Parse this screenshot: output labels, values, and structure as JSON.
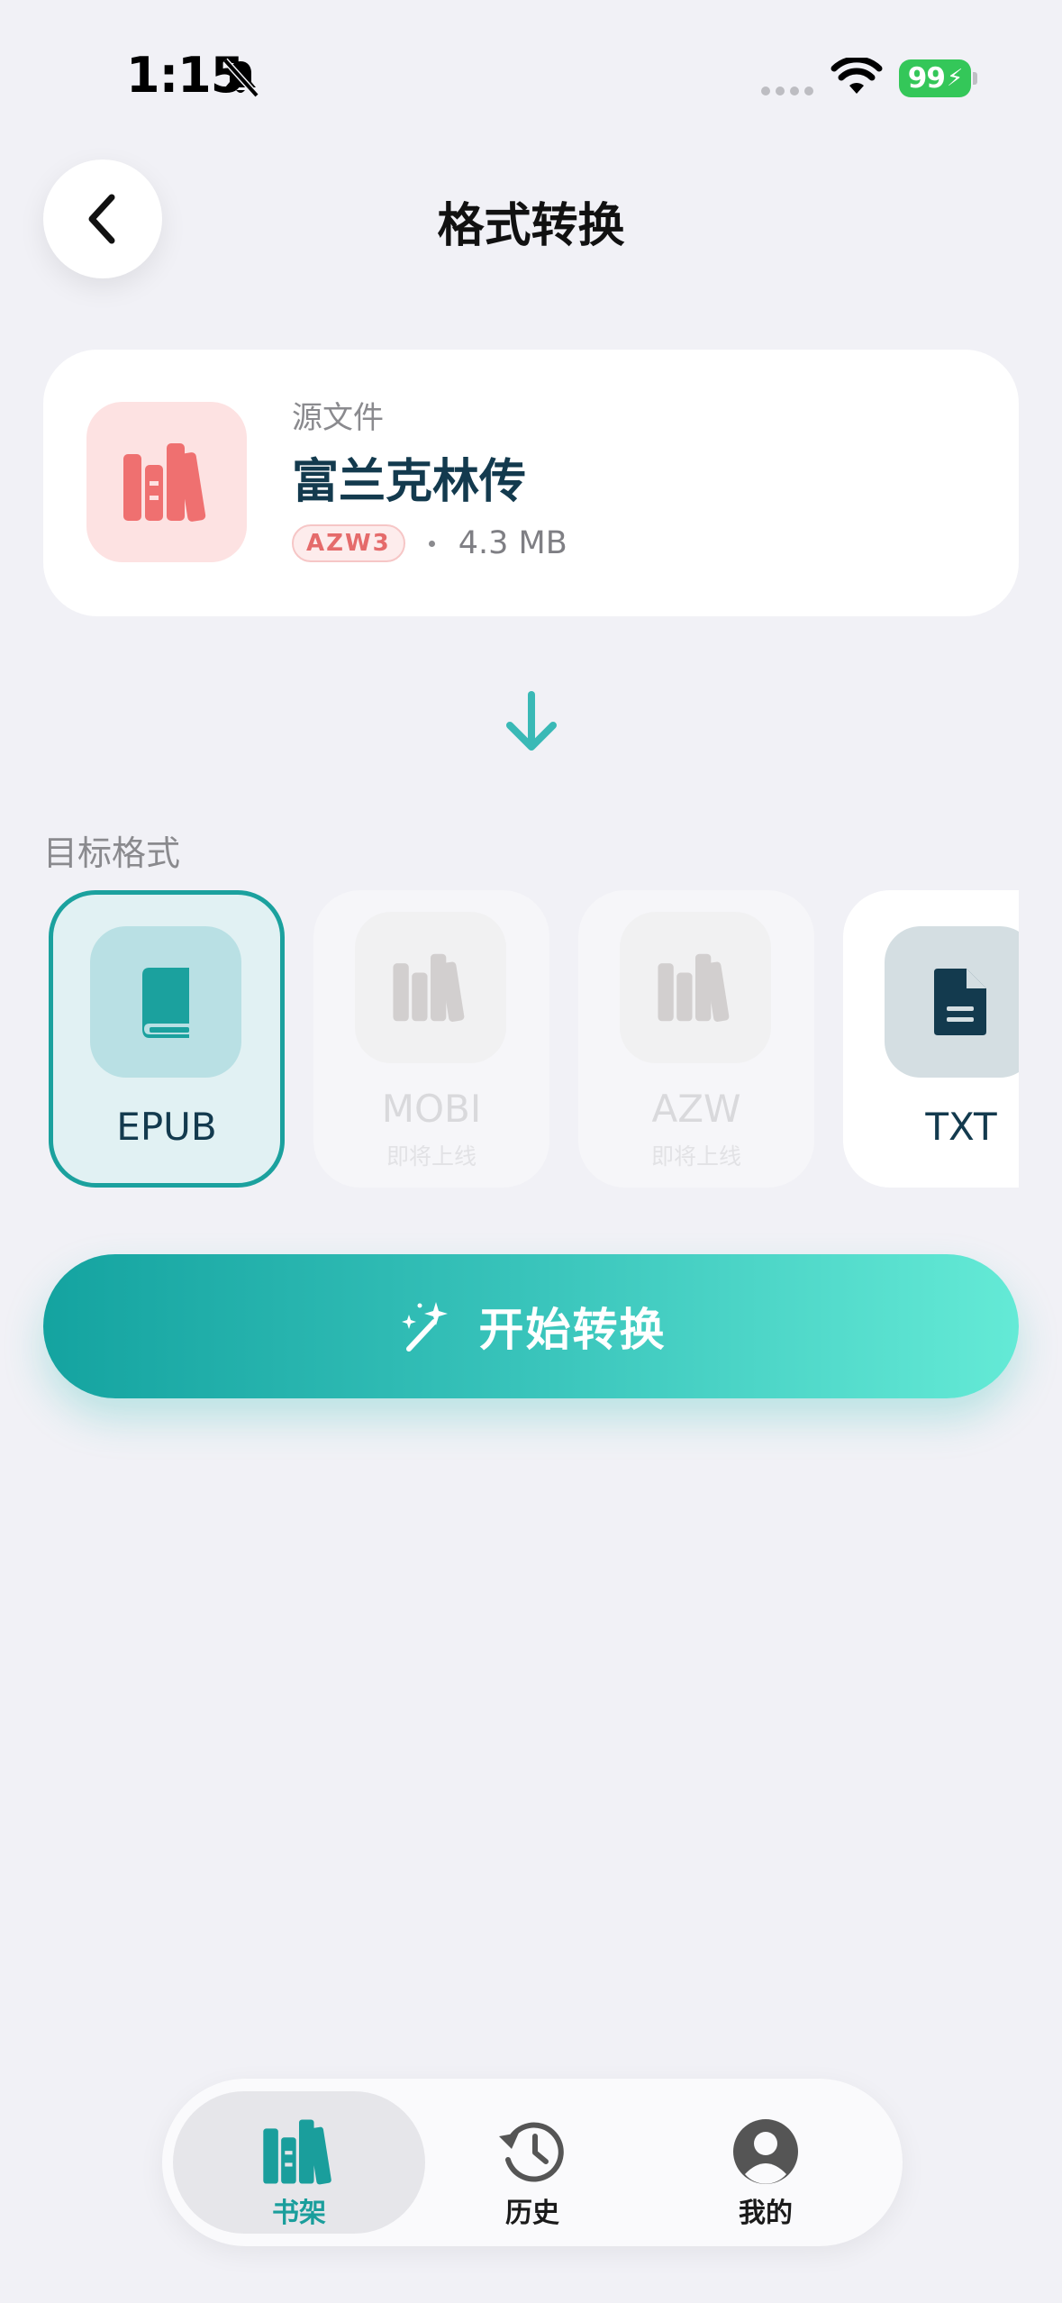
{
  "status_bar": {
    "time": "1:15",
    "battery": "99"
  },
  "header": {
    "title": "格式转换",
    "back_icon": "chevron-left-icon"
  },
  "source": {
    "label": "源文件",
    "title": "富兰克林传",
    "format": "AZW3",
    "size": "4.3 MB",
    "icon": "books-icon"
  },
  "target": {
    "label": "目标格式",
    "formats": [
      {
        "name": "EPUB",
        "icon": "book-icon",
        "state": "selected"
      },
      {
        "name": "MOBI",
        "sub": "即将上线",
        "icon": "books-icon",
        "state": "disabled"
      },
      {
        "name": "AZW",
        "sub": "即将上线",
        "icon": "books-icon",
        "state": "disabled"
      },
      {
        "name": "TXT",
        "icon": "document-icon",
        "state": "available"
      }
    ]
  },
  "action": {
    "start_label": "开始转换"
  },
  "tabs": [
    {
      "label": "书架",
      "icon": "bookshelf-icon",
      "active": true
    },
    {
      "label": "历史",
      "icon": "history-icon",
      "active": false
    },
    {
      "label": "我的",
      "icon": "profile-icon",
      "active": false
    }
  ],
  "colors": {
    "accent": "#1ba19e",
    "source_icon": "#ef7070",
    "title_dark": "#133a4e"
  }
}
